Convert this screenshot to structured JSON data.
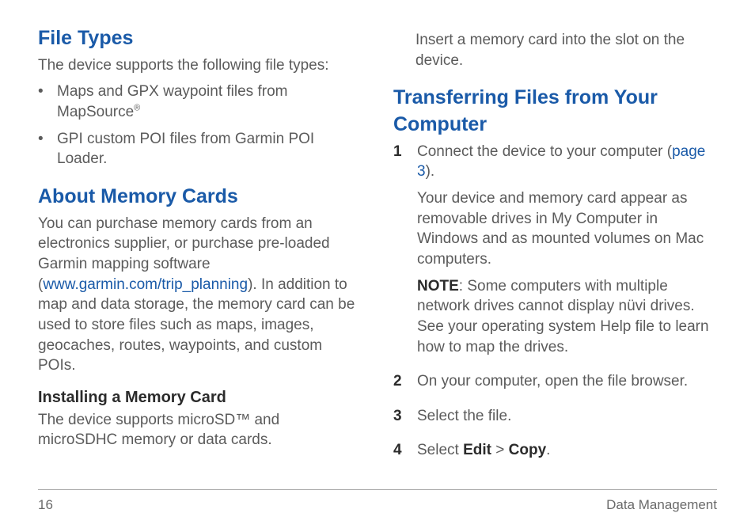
{
  "left": {
    "file_types": {
      "heading": "File Types",
      "intro": "The device supports the following file types:",
      "bullets": [
        {
          "pre": "Maps and GPX waypoint files from MapSource",
          "sup": "®"
        },
        {
          "pre": "GPI custom POI files from Garmin POI Loader."
        }
      ]
    },
    "memory_cards": {
      "heading": "About Memory Cards",
      "para_pre": "You can purchase memory cards from an electronics supplier, or purchase pre-loaded Garmin mapping software (",
      "link_text": "www.garmin.com/trip_planning",
      "para_post": "). In addition to map and data storage, the memory card can be used to store files such as maps, images, geocaches, routes, waypoints, and custom POIs.",
      "install_heading": "Installing a Memory Card",
      "install_text": "The device supports microSD™ and microSDHC memory or data cards."
    }
  },
  "right": {
    "insert_text": "Insert a memory card into the slot on the device.",
    "transfer": {
      "heading": "Transferring Files from Your Computer",
      "steps": [
        {
          "num": "1",
          "main_pre": "Connect the device to your computer (",
          "link": "page 3",
          "main_post": ").",
          "para2": "Your device and memory card appear as removable drives in My Computer in Windows and as mounted volumes on Mac computers.",
          "note_label": "NOTE",
          "note_text": ": Some computers with multiple network drives cannot display nüvi drives. See your operating system Help file to learn how to map the drives."
        },
        {
          "num": "2",
          "main": "On your computer, open the file browser."
        },
        {
          "num": "3",
          "main": "Select the file."
        },
        {
          "num": "4",
          "main_pre": "Select ",
          "bold1": "Edit",
          "mid": " > ",
          "bold2": "Copy",
          "main_post": "."
        }
      ]
    }
  },
  "footer": {
    "page_number": "16",
    "section_name": "Data Management"
  }
}
